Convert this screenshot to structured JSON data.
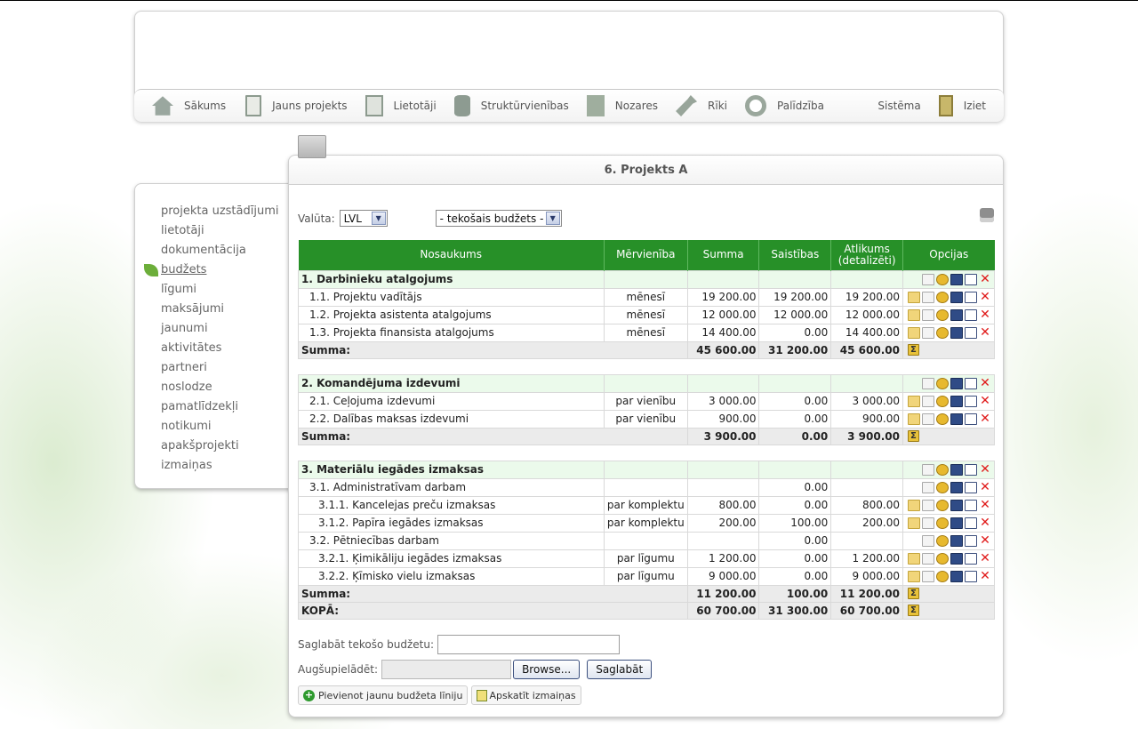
{
  "nav": {
    "items": [
      {
        "label": "Sākums",
        "icon": "home-icon"
      },
      {
        "label": "Jauns projekts",
        "icon": "document-icon"
      },
      {
        "label": "Lietotāji",
        "icon": "user-icon"
      },
      {
        "label": "Struktūrvienības",
        "icon": "database-icon"
      },
      {
        "label": "Nozares",
        "icon": "building-icon"
      },
      {
        "label": "Rīki",
        "icon": "wrench-icon"
      },
      {
        "label": "Palīdzība",
        "icon": "lifebuoy-icon"
      }
    ],
    "right": {
      "system": "Sistēma",
      "exit": "Iziet"
    }
  },
  "sidebar": {
    "items": [
      {
        "label": "projekta uzstādījumi"
      },
      {
        "label": "lietotāji"
      },
      {
        "label": "dokumentācija"
      },
      {
        "label": "budžets",
        "active": true
      },
      {
        "label": "līgumi"
      },
      {
        "label": "maksājumi"
      },
      {
        "label": "jaunumi"
      },
      {
        "label": "aktivitātes"
      },
      {
        "label": "partneri"
      },
      {
        "label": "noslodze"
      },
      {
        "label": "pamatlīdzekļi"
      },
      {
        "label": "notikumi"
      },
      {
        "label": "apakšprojekti"
      },
      {
        "label": "izmaiņas"
      }
    ]
  },
  "main": {
    "title": "6. Projekts A",
    "currency_label": "Valūta:",
    "currency_value": "LVL",
    "budget_select": "- tekošais budžets -"
  },
  "table": {
    "headers": {
      "name": "Nosaukums",
      "unit": "Mērvienība",
      "sum": "Summa",
      "commitments": "Saistības",
      "remaining_1": "Atlikums",
      "remaining_2": "(detalizēti)",
      "options": "Opcijas"
    },
    "rows": [
      {
        "type": "section",
        "name": "1. Darbinieku atalgojums"
      },
      {
        "type": "item",
        "level": 1,
        "name": "1.1. Projektu vadītājs",
        "unit": "mēnesī",
        "sum": "19 200.00",
        "commit": "19 200.00",
        "rest": "19 200.00"
      },
      {
        "type": "item",
        "level": 1,
        "name": "1.2. Projekta asistenta atalgojums",
        "unit": "mēnesī",
        "sum": "12 000.00",
        "commit": "12 000.00",
        "rest": "12 000.00"
      },
      {
        "type": "item",
        "level": 1,
        "name": "1.3. Projekta finansista atalgojums",
        "unit": "mēnesī",
        "sum": "14 400.00",
        "commit": "0.00",
        "rest": "14 400.00"
      },
      {
        "type": "sum",
        "name": "Summa:",
        "sum": "45 600.00",
        "commit": "31 200.00",
        "rest": "45 600.00"
      },
      {
        "type": "blank"
      },
      {
        "type": "section",
        "name": "2. Komandējuma izdevumi"
      },
      {
        "type": "item",
        "level": 1,
        "name": "2.1. Ceļojuma izdevumi",
        "unit": "par vienību",
        "sum": "3 000.00",
        "commit": "0.00",
        "rest": "3 000.00"
      },
      {
        "type": "item",
        "level": 1,
        "name": "2.2. Dalības maksas izdevumi",
        "unit": "par vienību",
        "sum": "900.00",
        "commit": "0.00",
        "rest": "900.00"
      },
      {
        "type": "sum",
        "name": "Summa:",
        "sum": "3 900.00",
        "commit": "0.00",
        "rest": "3 900.00"
      },
      {
        "type": "blank"
      },
      {
        "type": "section",
        "name": "3. Materiālu iegādes izmaksas"
      },
      {
        "type": "group",
        "level": 1,
        "name": "3.1. Administratīvam darbam",
        "unit": "",
        "sum": "",
        "commit": "0.00",
        "rest": ""
      },
      {
        "type": "item",
        "level": 2,
        "name": "3.1.1. Kancelejas preču izmaksas",
        "unit": "par komplektu",
        "sum": "800.00",
        "commit": "0.00",
        "rest": "800.00"
      },
      {
        "type": "item",
        "level": 2,
        "name": "3.1.2. Papīra iegādes izmaksas",
        "unit": "par komplektu",
        "sum": "200.00",
        "commit": "100.00",
        "rest": "200.00"
      },
      {
        "type": "group",
        "level": 1,
        "name": "3.2. Pētniecības darbam",
        "unit": "",
        "sum": "",
        "commit": "0.00",
        "rest": ""
      },
      {
        "type": "item",
        "level": 2,
        "name": "3.2.1. Ķimikāliju iegādes izmaksas",
        "unit": "par līgumu",
        "sum": "1 200.00",
        "commit": "0.00",
        "rest": "1 200.00"
      },
      {
        "type": "item",
        "level": 2,
        "name": "3.2.2. Ķīmisko vielu izmaksas",
        "unit": "par līgumu",
        "sum": "9 000.00",
        "commit": "0.00",
        "rest": "9 000.00"
      },
      {
        "type": "sum",
        "name": "Summa:",
        "sum": "11 200.00",
        "commit": "100.00",
        "rest": "11 200.00"
      },
      {
        "type": "sum",
        "name": "KOPĀ:",
        "sum": "60 700.00",
        "commit": "31 300.00",
        "rest": "60 700.00"
      }
    ]
  },
  "form": {
    "save_label": "Saglabāt tekošo budžetu:",
    "save_value": "",
    "upload_label": "Augšupielādēt:",
    "browse_button": "Browse...",
    "save_button": "Saglabāt",
    "add_line_button": "Pievienot jaunu budžeta līniju",
    "view_changes_button": "Apskatīt izmaiņas"
  },
  "colors": {
    "table_header_bg": "#279028",
    "section_row_bg": "#ebfaeb",
    "sum_row_bg": "#ebebeb",
    "delete_icon": "#e01b1b"
  }
}
